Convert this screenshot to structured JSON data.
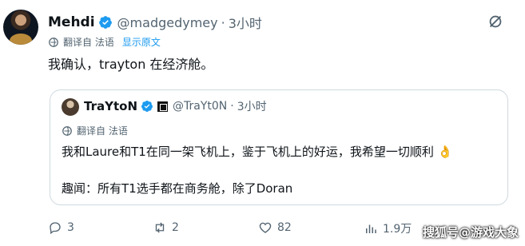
{
  "author": {
    "name": "Mehdi",
    "handle": "@madgedymey",
    "separator": "·",
    "time": "3小时"
  },
  "translation": {
    "label": "翻译自 法语",
    "show_original": "显示原文"
  },
  "tweet_text": "我确认，trayton 在经济舱。",
  "quote": {
    "name": "TraYtoN",
    "handle": "@TraYt0N",
    "separator": "·",
    "time": "3小时",
    "translation_label": "翻译自 法语",
    "text_line1": "我和Laure和T1在同一架飞机上，鉴于飞机上的好运，我希望一切顺利 👌",
    "text_line2": "趣闻：所有T1选手都在商务舱，除了Doran"
  },
  "actions": {
    "reply_count": "3",
    "retweet_count": "2",
    "like_count": "82",
    "view_count": "1.9万"
  },
  "watermark": "搜狐号@游戏大象",
  "colors": {
    "accent": "#1d9bf0",
    "muted": "#536471",
    "text": "#0f1419",
    "border": "#cfd9de"
  }
}
